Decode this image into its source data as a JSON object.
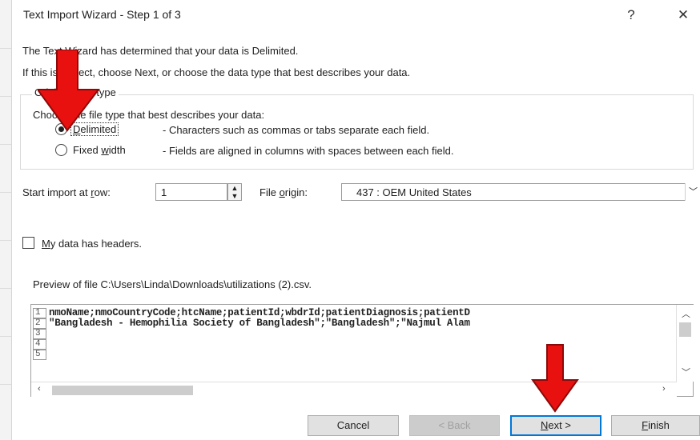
{
  "window": {
    "title": "Text Import Wizard - Step 1 of 3",
    "help_label": "?",
    "close_label": "✕"
  },
  "intro": {
    "line1": "The Text Wizard has determined that your data is Delimited.",
    "line2": "If this is correct, choose Next, or choose the data type that best describes your data."
  },
  "data_type": {
    "legend": "Original data type",
    "prompt": "Choose the file type that best describes your data:",
    "options": [
      {
        "label": "Delimited",
        "description": "- Characters such as commas or tabs separate each field.",
        "selected": true
      },
      {
        "label": "Fixed width",
        "description": "- Fields are aligned in columns with spaces between each field.",
        "selected": false
      }
    ]
  },
  "import": {
    "start_row_label": "Start import at row:",
    "start_row_value": "1",
    "file_origin_label": "File origin:",
    "file_origin_value": "437 : OEM United States"
  },
  "headers": {
    "label": "My data has headers.",
    "checked": false
  },
  "preview": {
    "label": "Preview of file C:\\Users\\Linda\\Downloads\\utilizations (2).csv.",
    "lines": [
      {
        "num": "1",
        "text": "nmoName;nmoCountryCode;htcName;patientId;wbdrId;patientDiagnosis;patientD"
      },
      {
        "num": "2",
        "text": "\"Bangladesh - Hemophilia Society of Bangladesh\";\"Bangladesh\";\"Najmul Alam"
      },
      {
        "num": "3",
        "text": ""
      },
      {
        "num": "4",
        "text": ""
      },
      {
        "num": "5",
        "text": ""
      }
    ]
  },
  "buttons": {
    "cancel": "Cancel",
    "back": "< Back",
    "next": "Next >",
    "finish": "Finish"
  },
  "colors": {
    "arrow": "#e8110f",
    "default_button_border": "#0078d7"
  }
}
